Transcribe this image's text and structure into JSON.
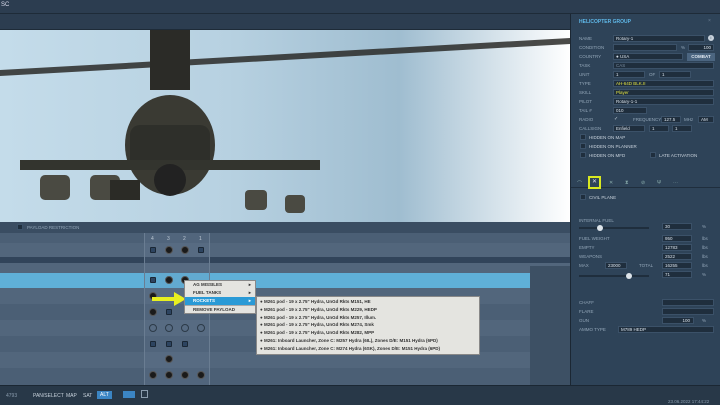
{
  "app": {
    "title": "SC"
  },
  "payload": {
    "restriction_label": "PAYLOAD RESTRICTION",
    "columns": [
      "4",
      "3",
      "2",
      "1"
    ]
  },
  "context_menu": {
    "items": [
      {
        "label": "AG MISSILES",
        "has_submenu": true
      },
      {
        "label": "FUEL TANKS",
        "has_submenu": true
      },
      {
        "label": "ROCKETS",
        "has_submenu": true,
        "selected": true
      },
      {
        "label": "REMOVE PAYLOAD",
        "has_submenu": false
      }
    ]
  },
  "rockets_submenu": [
    "M261 pod - 19 x 2.75\" Hydra, UnGd Rkts M151, HE",
    "M261 pod - 19 x 2.75\" Hydra, UnGd Rkts M229, HEDP",
    "M261 pod - 19 x 2.75\" Hydra, UnGd Rkts M257, Illum.",
    "M261 pod - 19 x 2.75\" Hydra, UnGd Rkts M274, Smk",
    "M261 pod - 19 x 2.75\" Hydra, UnGd Rkts M282, MPP",
    "M261: Inboard Launcher, Zone C: M257 Hydra (6IL), Zones D/E: M151 Hydra (6PD)",
    "M261: Inboard Launcher, Zone C: M274 Hydra (6SK), Zones D/E: M151 Hydra (6PD)"
  ],
  "panel": {
    "title": "HELICOPTER GROUP",
    "name_label": "NAME",
    "name": "Rotary-1",
    "condition_label": "CONDITION",
    "condition_unit": "%",
    "condition_value": "100",
    "country_label": "COUNTRY",
    "country": "USA",
    "combat_button": "COMBAT",
    "task_label": "TASK",
    "task": "CAS",
    "unit_label": "UNIT",
    "unit": "1",
    "of_label": "OF",
    "unit_total": "1",
    "type_label": "TYPE",
    "type": "AH-64D BLK.II",
    "skill_label": "SKILL",
    "skill": "Player",
    "pilot_label": "PILOT",
    "pilot": "Rotary-1-1",
    "tail_label": "TAIL #",
    "tail": "010",
    "radio_label": "RADIO",
    "radio_check": "✓",
    "frequency_label": "FREQUENCY",
    "frequency": "127.5",
    "mhz": "MHz",
    "modulation": "AM",
    "callsign_label": "CALLSIGN",
    "callsign": "Enfield",
    "callsign_n1": "1",
    "callsign_n2": "1",
    "hidden_map": "HIDDEN ON MAP",
    "hidden_planner": "HIDDEN ON PLANNER",
    "hidden_mfd": "HIDDEN ON MFD",
    "late_activation": "LATE ACTIVATION",
    "civil_plane": "CIVIL PLANE",
    "internal_fuel_label": "INTERNAL FUEL",
    "internal_fuel": "30",
    "internal_fuel_pct": 30,
    "pct": "%",
    "fuel_weight_label": "FUEL WEIGHT",
    "fuel_weight": "950",
    "lbs": "lbs",
    "empty_label": "EMPTY",
    "empty": "12783",
    "weapons_label": "WEAPONS",
    "weapons": "2522",
    "max_label": "MAX",
    "max": "23000",
    "total_label": "TOTAL",
    "total": "16255",
    "load_pct": "71",
    "load_pct_value": 71,
    "chaff_label": "CHAFF",
    "flare_label": "FLARE",
    "gun_label": "GUN",
    "gun": "100",
    "ammo_label": "AMMO TYPE",
    "ammo": "M789 HEDP"
  },
  "status": {
    "coords": "4793",
    "modes": [
      "PAN/SELECT",
      "MAP",
      "SAT",
      "ALT"
    ],
    "active_mode": "ALT",
    "datetime": "23.06.2022 17:44:22"
  },
  "colors": {
    "accent": "#2a9ad6",
    "highlight_row": "#5fb0d8",
    "tab_highlight": "#d8e820",
    "arrow": "#e8f020"
  }
}
